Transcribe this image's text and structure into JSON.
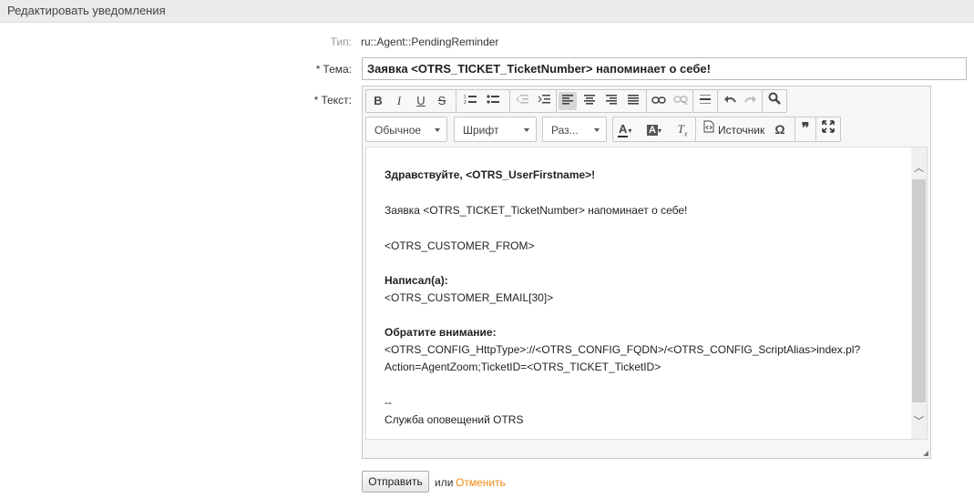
{
  "header": {
    "title": "Редактировать уведомления"
  },
  "form": {
    "type_label": "Тип:",
    "type_value": "ru::Agent::PendingReminder",
    "subject_label": "Тема:",
    "subject_value": "Заявка <OTRS_TICKET_TicketNumber> напоминает о себе!",
    "text_label": "Текст:",
    "required_mark": "*"
  },
  "editor": {
    "toolbar": {
      "format_combo": "Обычное",
      "font_combo": "Шрифт",
      "size_combo": "Раз...",
      "source_label": "Источник",
      "icons": [
        "bold-icon",
        "italic-icon",
        "underline-icon",
        "strike-icon",
        "numbered-list-icon",
        "bulleted-list-icon",
        "outdent-icon",
        "indent-icon",
        "align-left-icon",
        "align-center-icon",
        "align-right-icon",
        "justify-icon",
        "link-icon",
        "unlink-icon",
        "horizontal-rule-icon",
        "undo-icon",
        "redo-icon",
        "find-icon",
        "text-color-icon",
        "background-color-icon",
        "remove-format-icon",
        "source-icon",
        "special-char-icon",
        "blockquote-icon",
        "maximize-icon"
      ]
    },
    "content": {
      "greeting": "Здравствуйте, <OTRS_UserFirstname>!",
      "line1": "Заявка <OTRS_TICKET_TicketNumber> напоминает о себе!",
      "line2": "<OTRS_CUSTOMER_FROM>",
      "wrote_label": "Написал(а):",
      "wrote_value": "<OTRS_CUSTOMER_EMAIL[30]>",
      "attention_label": "Обратите внимание:",
      "url_line1": "<OTRS_CONFIG_HttpType>://<OTRS_CONFIG_FQDN>/<OTRS_CONFIG_ScriptAlias>index.pl?",
      "url_line2": "Action=AgentZoom;TicketID=<OTRS_TICKET_TicketID>",
      "signature_sep": "--",
      "signature": "Служба оповещений OTRS"
    }
  },
  "actions": {
    "submit_label": "Отправить",
    "or_text": "или",
    "cancel_label": "Отменить"
  },
  "colors": {
    "cancel_link": "#f28a14",
    "header_bg": "#ebebeb"
  }
}
